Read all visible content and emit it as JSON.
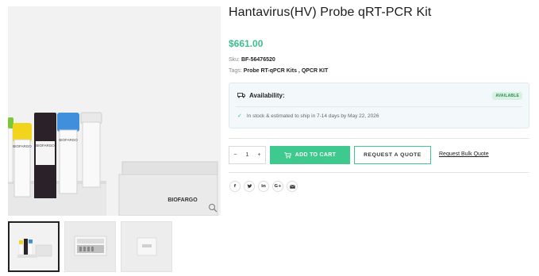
{
  "product": {
    "title": "Hantavirus(HV) Probe qRT-PCR Kit",
    "price": "$661.00",
    "sku_label": "Sku:",
    "sku_value": "BF-56476520",
    "tags_label": "Tags:",
    "tags": [
      "Probe RT-qPCR Kits",
      "QPCR KIT"
    ],
    "tags_separator": " , ",
    "image_brand_text": "BIOFARGO",
    "image_box_label": "BIOFARGO"
  },
  "availability": {
    "heading": "Availability:",
    "badge": "AVAILABLE",
    "message": "In stock & estimated to ship in 7-14 days by May 22, 2026"
  },
  "purchase": {
    "quantity": "1",
    "minus": "−",
    "plus": "+",
    "add_to_cart": "ADD TO CART",
    "request_quote": "REQUEST A QUOTE",
    "bulk_quote": "Request Bulk Quote"
  },
  "share": {
    "icons": [
      "facebook-icon",
      "twitter-icon",
      "linkedin-icon",
      "google-plus-icon",
      "email-icon"
    ]
  },
  "colors": {
    "accent": "#3ec98e",
    "price": "#3cbf8c",
    "available_badge_bg": "#d9f2e3",
    "tube_cap_yellow": "#f2d41a",
    "tube_cap_black": "#2a2228",
    "tube_cap_blue": "#3f8fdc",
    "tube_cap_green": "#7cc83a"
  },
  "gallery": {
    "thumbnails": [
      "thumb-kit-tubes",
      "thumb-kit-box-open",
      "thumb-kit-box-closed"
    ],
    "active_index": 0
  }
}
